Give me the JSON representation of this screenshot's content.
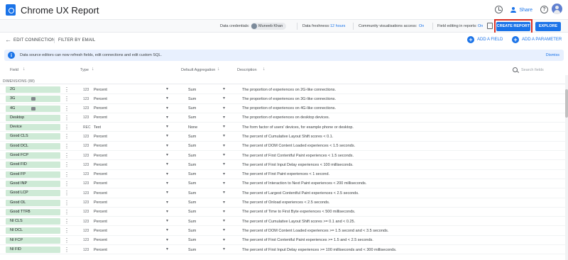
{
  "app": {
    "title": "Chrome UX Report"
  },
  "toolbar": {
    "share_label": "Share",
    "help_glyph": "?"
  },
  "infobar": {
    "credentials_label": "Data credentials:",
    "owner": "Muneeb Khan",
    "freshness_label": "Data freshness:",
    "freshness_value": "12 hours",
    "community_label": "Community visualisations access:",
    "community_value": "On",
    "editing_label": "Field editing in reports:",
    "editing_value": "On",
    "create_report": "CREATE REPORT",
    "explore": "EXPLORE"
  },
  "subbar": {
    "edit_connection": "EDIT CONNECTION",
    "filter_by_email": "FILTER BY EMAIL",
    "add_field": "ADD A FIELD",
    "add_parameter": "ADD A PARAMETER"
  },
  "banner": {
    "text": "Data source editors can now refresh fields, edit connections and edit custom SQL.",
    "dismiss": "Dismiss"
  },
  "columns": {
    "field": "Field",
    "type": "Type",
    "aggregation": "Default Aggregation",
    "description": "Description",
    "search_placeholder": "Search fields"
  },
  "section": {
    "dimensions": "DIMENSIONS (88)"
  },
  "rows": [
    {
      "field": "2G",
      "has_tag": false,
      "type_icon": "123",
      "type": "Percent",
      "agg": "Sum",
      "desc": "The proportion of experiences on 2G-like connections."
    },
    {
      "field": "3G",
      "has_tag": true,
      "type_icon": "123",
      "type": "Percent",
      "agg": "Sum",
      "desc": "The proportion of experiences on 3G-like connections."
    },
    {
      "field": "4G",
      "has_tag": true,
      "type_icon": "123",
      "type": "Percent",
      "agg": "Sum",
      "desc": "The proportion of experiences on 4G-like connections."
    },
    {
      "field": "Desktop",
      "has_tag": false,
      "type_icon": "123",
      "type": "Percent",
      "agg": "Sum",
      "desc": "The proportion of experiences on desktop devices."
    },
    {
      "field": "Device",
      "has_tag": false,
      "type_icon": "REC",
      "type": "Text",
      "agg": "None",
      "desc": "The form factor of users' devices, for example phone or desktop."
    },
    {
      "field": "Good CLS",
      "has_tag": false,
      "type_icon": "123",
      "type": "Percent",
      "agg": "Sum",
      "desc": "The percent of Cumulative Layout Shift scores < 0.1."
    },
    {
      "field": "Good DCL",
      "has_tag": false,
      "type_icon": "123",
      "type": "Percent",
      "agg": "Sum",
      "desc": "The percent of DOM Content Loaded experiences < 1.5 seconds."
    },
    {
      "field": "Good FCP",
      "has_tag": false,
      "type_icon": "123",
      "type": "Percent",
      "agg": "Sum",
      "desc": "The percent of First Contentful Paint experiences < 1.5 seconds."
    },
    {
      "field": "Good FID",
      "has_tag": false,
      "type_icon": "123",
      "type": "Percent",
      "agg": "Sum",
      "desc": "The percent of First Input Delay experiences < 100 milliseconds."
    },
    {
      "field": "Good FP",
      "has_tag": false,
      "type_icon": "123",
      "type": "Percent",
      "agg": "Sum",
      "desc": "The percent of First Paint experiences < 1 second."
    },
    {
      "field": "Good INP",
      "has_tag": false,
      "type_icon": "123",
      "type": "Percent",
      "agg": "Sum",
      "desc": "The percent of Interaction to Next Paint experiences < 200 milliseconds."
    },
    {
      "field": "Good LCP",
      "has_tag": false,
      "type_icon": "123",
      "type": "Percent",
      "agg": "Sum",
      "desc": "The percent of Largest Contentful Paint experiences < 2.5 seconds."
    },
    {
      "field": "Good OL",
      "has_tag": false,
      "type_icon": "123",
      "type": "Percent",
      "agg": "Sum",
      "desc": "The percent of Onload experiences < 2.5 seconds."
    },
    {
      "field": "Good TTFB",
      "has_tag": false,
      "type_icon": "123",
      "type": "Percent",
      "agg": "Sum",
      "desc": "The percent of Time to First Byte experiences < 500 milliseconds."
    },
    {
      "field": "NI CLS",
      "has_tag": false,
      "type_icon": "123",
      "type": "Percent",
      "agg": "Sum",
      "desc": "The percent of Cumulative Layout Shift scores >= 0.1 and < 0.25."
    },
    {
      "field": "NI DCL",
      "has_tag": false,
      "type_icon": "123",
      "type": "Percent",
      "agg": "Sum",
      "desc": "The percent of DOM Content Loaded experiences >= 1.5 second and < 3.5 seconds."
    },
    {
      "field": "NI FCP",
      "has_tag": false,
      "type_icon": "123",
      "type": "Percent",
      "agg": "Sum",
      "desc": "The percent of First Contentful Paint experiences >= 1.5 and < 2.5 seconds."
    },
    {
      "field": "NI FID",
      "has_tag": false,
      "type_icon": "123",
      "type": "Percent",
      "agg": "Sum",
      "desc": "The percent of First Input Delay experiences >= 100 milliseconds and < 300 milliseconds."
    }
  ]
}
